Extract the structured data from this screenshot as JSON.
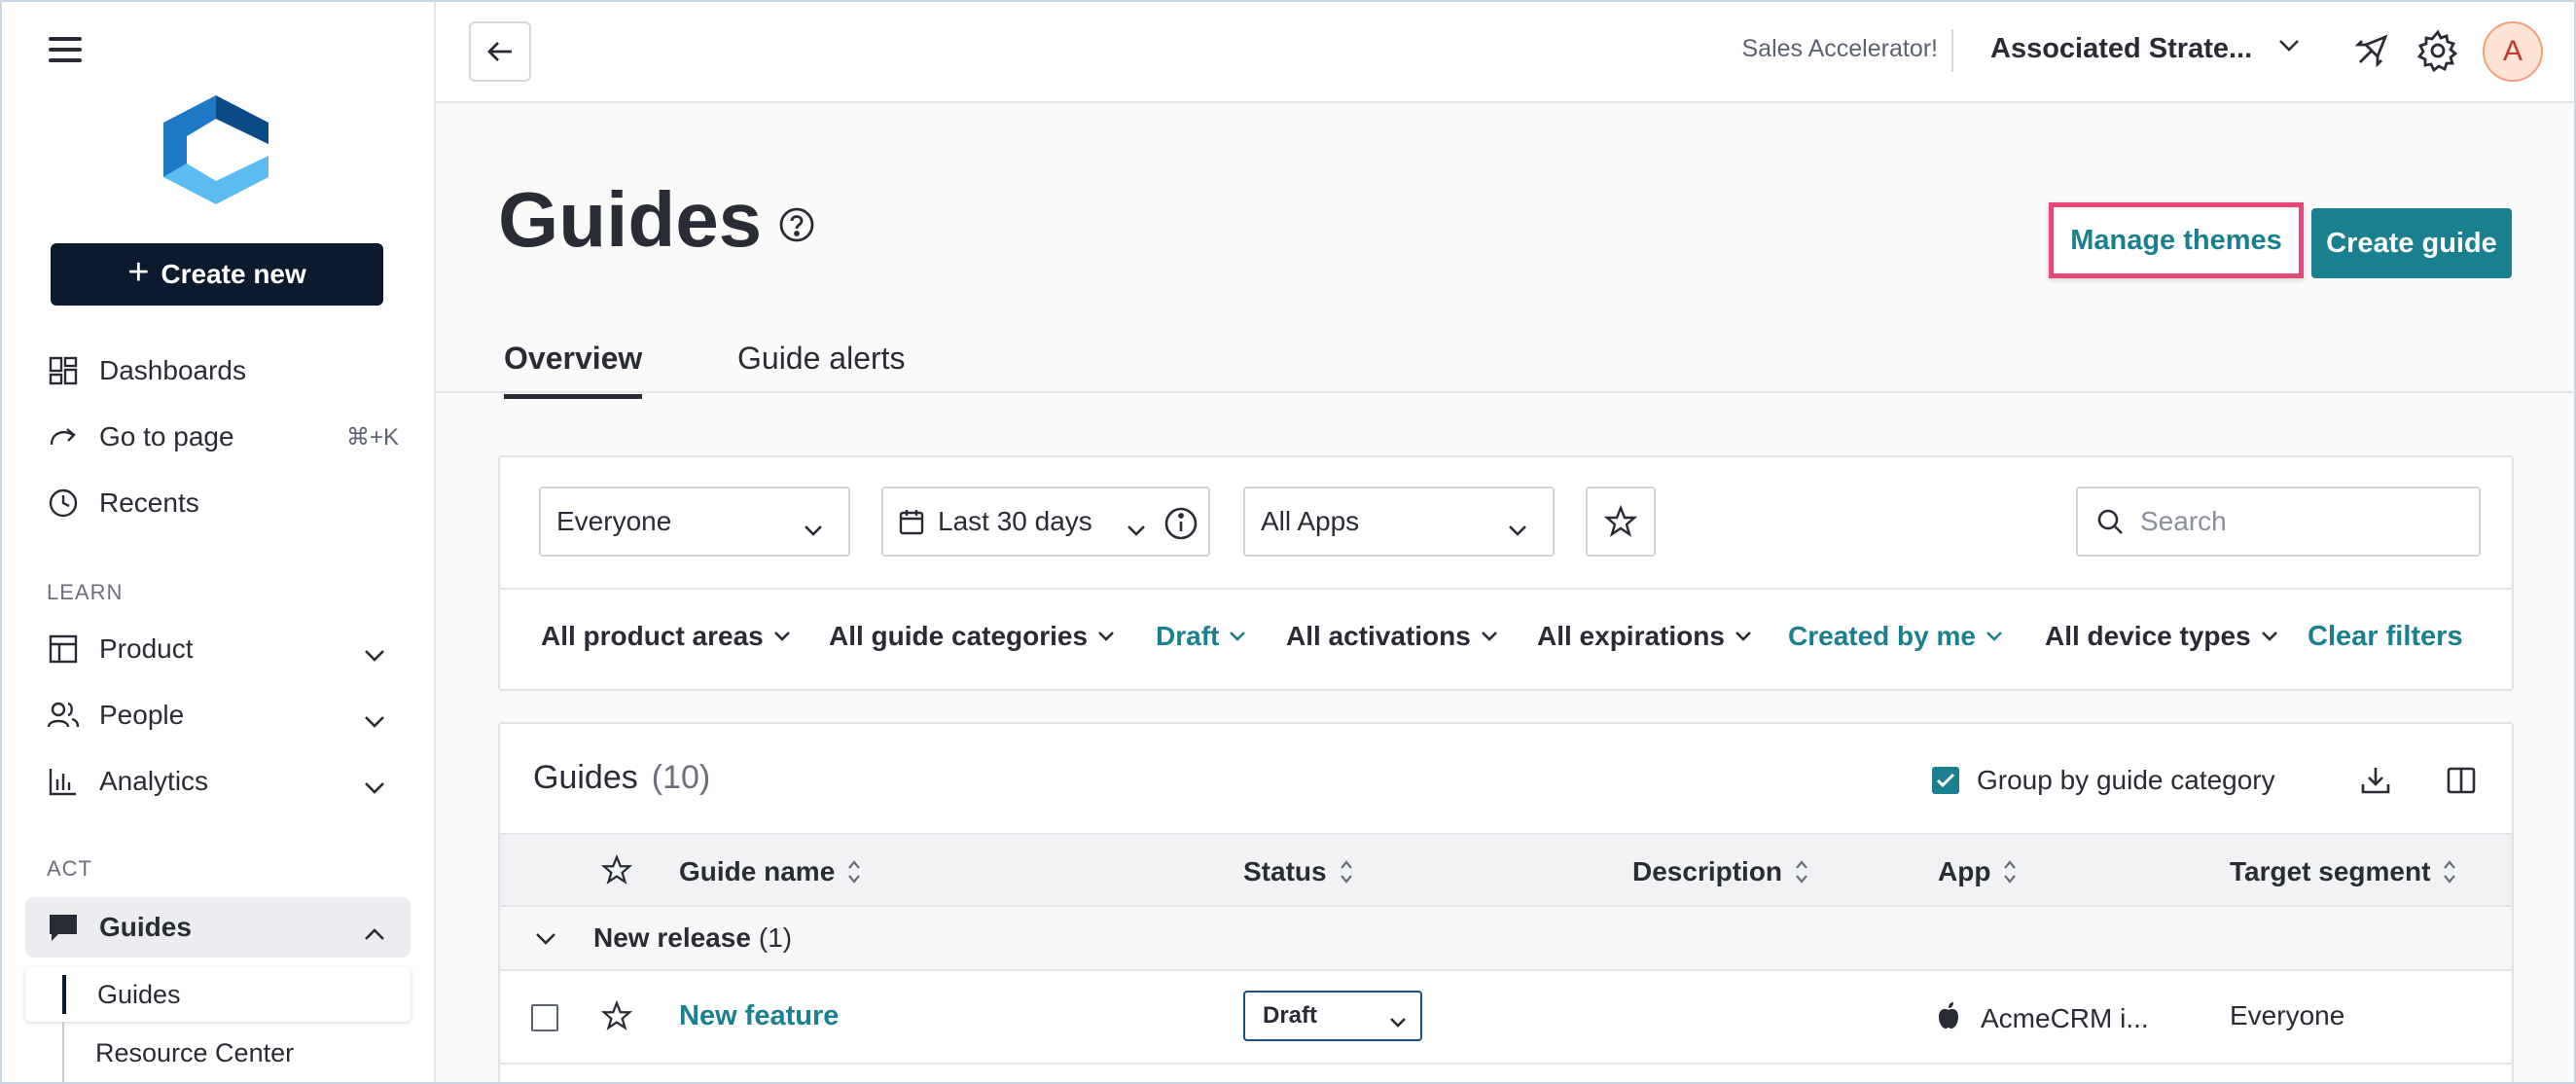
{
  "sidebar": {
    "create_new_label": "Create new",
    "items": [
      {
        "label": "Dashboards"
      },
      {
        "label": "Go to page",
        "shortcut": "⌘+K"
      },
      {
        "label": "Recents"
      }
    ],
    "learn_label": "LEARN",
    "learn_items": [
      {
        "label": "Product"
      },
      {
        "label": "People"
      },
      {
        "label": "Analytics"
      }
    ],
    "act_label": "ACT",
    "guides_label": "Guides",
    "guides_sub": [
      {
        "label": "Guides"
      },
      {
        "label": "Resource Center"
      }
    ]
  },
  "topbar": {
    "sales_accelerator": "Sales Accelerator!",
    "account_name": "Associated Strate...",
    "avatar_initial": "A"
  },
  "page": {
    "title": "Guides",
    "manage_themes_label": "Manage themes",
    "create_guide_label": "Create guide",
    "tabs": [
      {
        "label": "Overview",
        "active": true
      },
      {
        "label": "Guide alerts",
        "active": false
      }
    ]
  },
  "filters": {
    "segment": "Everyone",
    "date_range": "Last 30 days",
    "apps": "All Apps",
    "search_placeholder": "Search",
    "chips": [
      {
        "label": "All product areas",
        "active": false
      },
      {
        "label": "All guide categories",
        "active": false
      },
      {
        "label": "Draft",
        "active": true
      },
      {
        "label": "All activations",
        "active": false
      },
      {
        "label": "All expirations",
        "active": false
      },
      {
        "label": "Created by me",
        "active": true
      },
      {
        "label": "All device types",
        "active": false
      }
    ],
    "clear_label": "Clear filters"
  },
  "table": {
    "title": "Guides",
    "count": "(10)",
    "group_by_label": "Group by guide category",
    "group_by_checked": true,
    "columns": [
      "Guide name",
      "Status",
      "Description",
      "App",
      "Target segment"
    ],
    "groups": [
      {
        "name": "New release",
        "count": "(1)",
        "rows": [
          {
            "name": "New feature",
            "status": "Draft",
            "description": "",
            "app": "AcmeCRM i...",
            "segment": "Everyone"
          }
        ]
      }
    ]
  },
  "colors": {
    "accent": "#1a7f8e",
    "sidebar_button": "#0b1a2e",
    "highlight": "#e8477a"
  }
}
